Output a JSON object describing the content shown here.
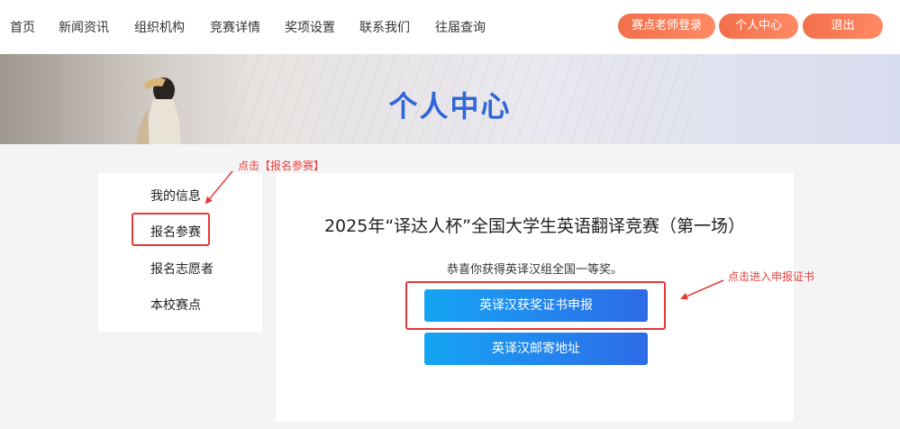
{
  "nav": {
    "items": [
      "首页",
      "新闻资讯",
      "组织机构",
      "竞赛详情",
      "奖项设置",
      "联系我们",
      "往届查询"
    ],
    "teacher_login": "赛点老师登录",
    "personal_center": "个人中心",
    "logout": "退出"
  },
  "banner": {
    "title": "个人中心"
  },
  "sidebar": {
    "items": [
      "我的信息",
      "报名参赛",
      "报名志愿者",
      "本校赛点"
    ]
  },
  "main": {
    "contest_title": "2025年“译达人杯”全国大学生英语翻译竞赛（第一场）",
    "congrats": "恭喜你获得英译汉组全国一等奖。",
    "cert_button": "英译汉获奖证书申报",
    "mail_button": "英译汉邮寄地址"
  },
  "annotations": {
    "click_register": "点击【报名参赛】",
    "click_certificate": "点击进入申报证书"
  },
  "colors": {
    "accent_orange": "#f26f4b",
    "title_blue": "#2f66d8",
    "button_blue_start": "#15a5f3",
    "button_blue_end": "#2e6be8",
    "annotation_red": "#e53935"
  }
}
